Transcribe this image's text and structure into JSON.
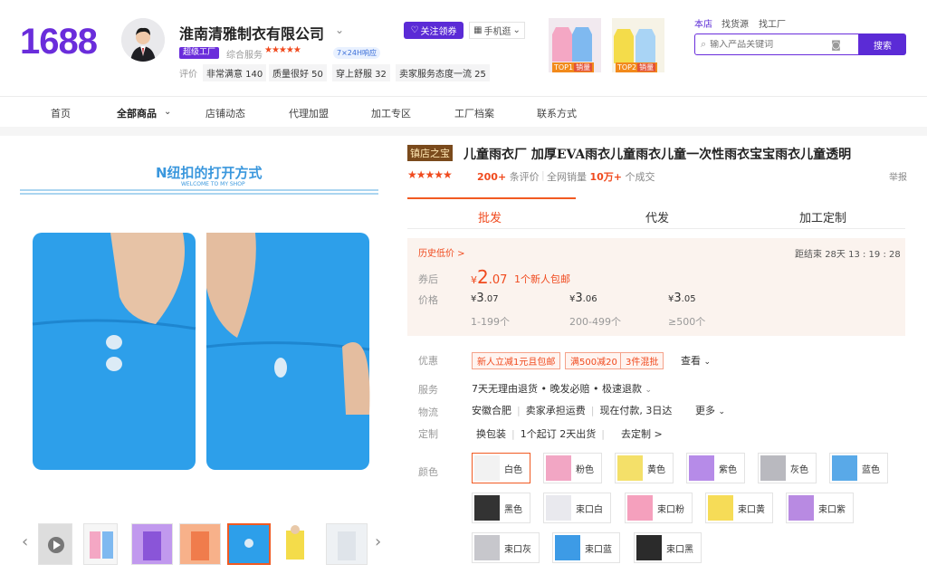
{
  "header": {
    "logo": "1688",
    "shop_name": "淮南清雅制衣有限公司",
    "badge_factory": "超级工厂",
    "service_label": "综合服务",
    "service_stars": "★★★★★",
    "service_tag": "7×24H响应",
    "eval_label": "评价",
    "eval_tags": [
      "非常满意 140",
      "质量很好 50",
      "穿上舒服 32",
      "卖家服务态度一流 25"
    ],
    "follow_label": "关注领券",
    "mobile_label": "手机逛",
    "top_tags": [
      {
        "label": "TOP1",
        "sub": "销量"
      },
      {
        "label": "TOP2",
        "sub": "销量"
      }
    ],
    "search_tabs": [
      "本店",
      "找货源",
      "找工厂"
    ],
    "search_placeholder": "输入产品关键词",
    "search_button": "搜索"
  },
  "nav": [
    "首页",
    "全部商品",
    "店铺动态",
    "代理加盟",
    "加工专区",
    "工厂档案",
    "联系方式"
  ],
  "gallery": {
    "main_caption": "N纽扣的打开方式",
    "main_subcaption": "WELCOME TO MY SHOP",
    "thumb_count": 8,
    "selected_thumb": 5
  },
  "product": {
    "title_badge": "镇店之宝",
    "title": "儿童雨衣厂 加厚EVA雨衣儿童雨衣儿童一次性雨衣宝宝雨衣儿童透明",
    "stars": "★★★★★",
    "reviews_count": "200+",
    "reviews_label": "条评价",
    "sales_label": "全网销量",
    "sales_count": "10万+",
    "sales_unit": "个成交",
    "report": "举报",
    "tabs": [
      "批发",
      "代发",
      "加工定制"
    ],
    "active_tab": "批发"
  },
  "price": {
    "history_label": "历史低价 >",
    "countdown_label": "距结束",
    "countdown": "28天 13 : 19 : 28",
    "coupon_label": "券后",
    "coupon_price_int": "2",
    "coupon_price_dec": ".07",
    "coupon_note": "1个新人包邮",
    "price_label": "价格",
    "tiers": [
      {
        "int": "3",
        "dec": ".07",
        "range": "1-199个"
      },
      {
        "int": "3",
        "dec": ".06",
        "range": "200-499个"
      },
      {
        "int": "3",
        "dec": ".05",
        "range": "≥500个"
      }
    ],
    "currency": "¥"
  },
  "details": {
    "promo_label": "优惠",
    "promos": [
      "新人立减1元且包邮",
      "满500减20",
      "3件混批"
    ],
    "promo_more": "查看",
    "service_label": "服务",
    "service_text": "7天无理由退货 • 晚发必赔 • 极速退款",
    "logistics_label": "物流",
    "logistics_items": [
      "安徽合肥",
      "卖家承担运费",
      "现在付款, 3日达",
      "更多"
    ],
    "custom_label": "定制",
    "custom_items": [
      "换包装",
      "1个起订 2天出货",
      "去定制 >"
    ],
    "color_label": "颜色",
    "colors": [
      "白色",
      "粉色",
      "黄色",
      "紫色",
      "灰色",
      "蓝色",
      "黑色",
      "束口白",
      "束口粉",
      "束口黄",
      "束口紫",
      "束口灰",
      "束口蓝",
      "束口黑"
    ],
    "color_swatch_hex": [
      "#f2f2f2",
      "#f2a6c4",
      "#f4e069",
      "#b68be8",
      "#b9b9bf",
      "#59a9e8",
      "#333333",
      "#e9e9ee",
      "#f5a0bd",
      "#f6dc57",
      "#b88ae2",
      "#c7c7cc",
      "#3d9be6",
      "#2b2b2b"
    ],
    "selected_color": "白色"
  },
  "colors": {
    "brand": "#5b2bd6",
    "accent": "#f04a1e"
  }
}
